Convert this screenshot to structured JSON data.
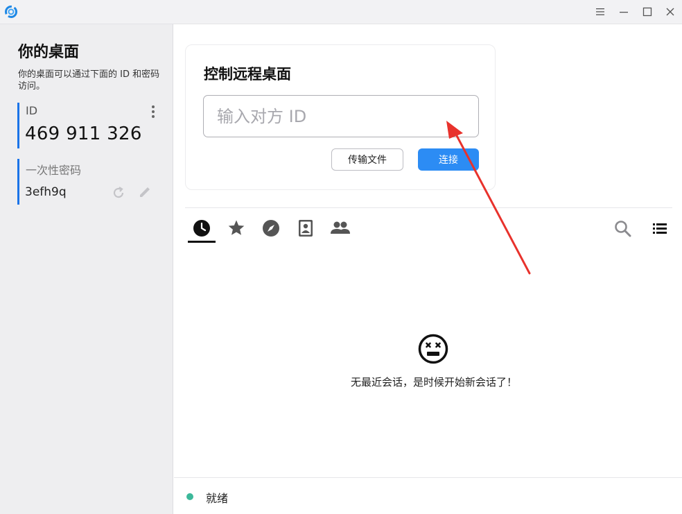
{
  "titlebar": {
    "logo_icon": "app-logo-icon",
    "controls": [
      "menu-icon",
      "minimize-icon",
      "maximize-icon",
      "close-icon"
    ]
  },
  "sidebar": {
    "title": "你的桌面",
    "description": "你的桌面可以通过下面的 ID 和密码访问。",
    "id_label": "ID",
    "id_value": "469 911 326",
    "password_label": "一次性密码",
    "password_value": "3efh9q"
  },
  "connect": {
    "title": "控制远程桌面",
    "input_placeholder": "输入对方 ID",
    "transfer_label": "传输文件",
    "connect_label": "连接"
  },
  "tabs": [
    {
      "icon": "clock-icon",
      "active": true
    },
    {
      "icon": "star-icon",
      "active": false
    },
    {
      "icon": "compass-icon",
      "active": false
    },
    {
      "icon": "address-book-icon",
      "active": false
    },
    {
      "icon": "group-icon",
      "active": false
    }
  ],
  "toolbar_icons": [
    "search-icon",
    "list-view-icon"
  ],
  "empty_state": {
    "icon": "sad-face-icon",
    "message": "无最近会话，是时候开始新会话了！"
  },
  "status": {
    "text": "就绪",
    "dot_color": "#3cb89a"
  },
  "colors": {
    "accent": "#2c8cf4",
    "id_border": "#1a73e8",
    "annotation": "#e8322c"
  }
}
